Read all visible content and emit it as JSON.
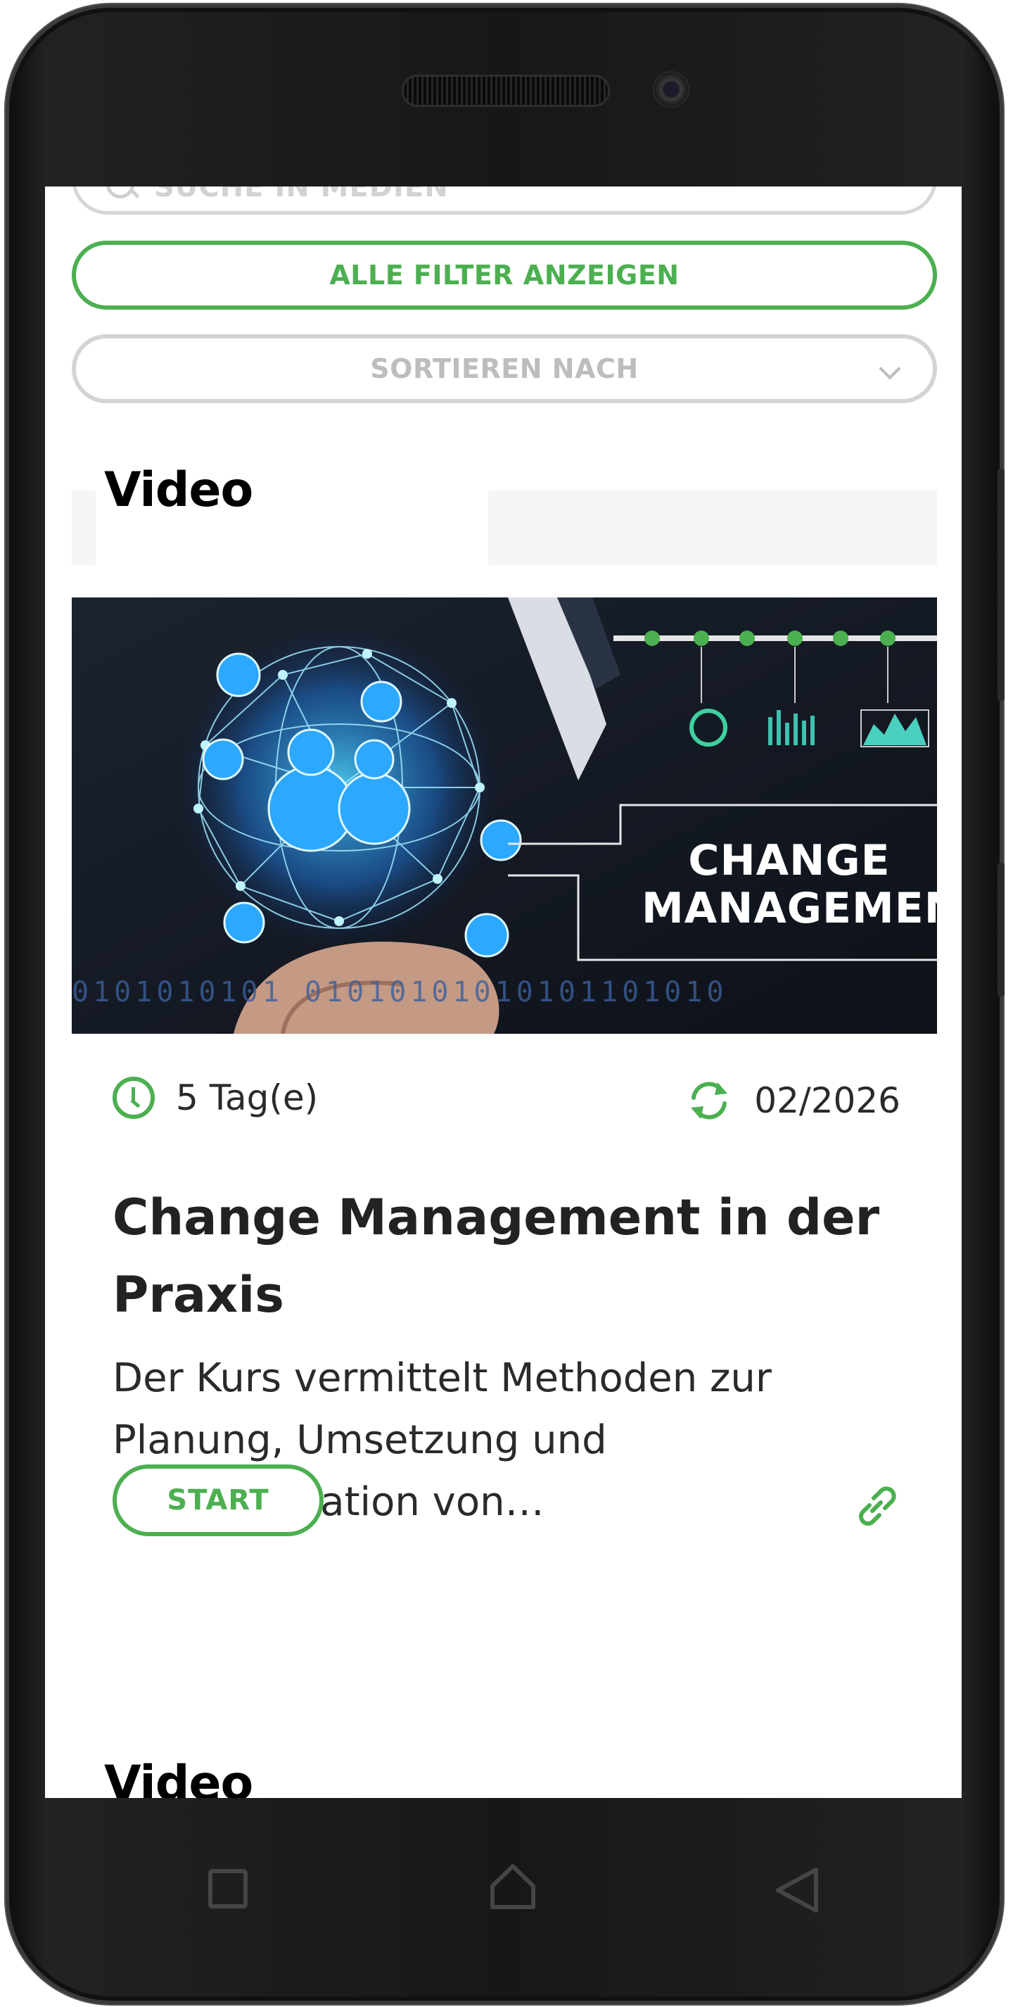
{
  "search": {
    "placeholder": "SUCHE IN MEDIEN"
  },
  "filters": {
    "show_all_label": "ALLE FILTER ANZEIGEN"
  },
  "sort": {
    "label": "SORTIEREN NACH"
  },
  "section": {
    "title": "Video"
  },
  "card": {
    "image_text_line1": "CHANGE",
    "image_text_line2": "MANAGEMENT",
    "image_binary": "0101010101 01010101010101101010",
    "duration": "5 Tag(e)",
    "update_date": "02/2026",
    "title": "Change Management in der Praxis",
    "description": "Der Kurs vermittelt Methoden zur Planung, Umsetzung und Kommunikation von…",
    "start_label": "START"
  },
  "next_section": {
    "title": "Video"
  },
  "colors": {
    "accent": "#4caf50",
    "border_gray": "#d4d4d4",
    "text_dark": "#222222"
  },
  "icons": [
    "search-icon",
    "chevron-down-icon",
    "clock-icon",
    "refresh-icon",
    "link-icon",
    "nav-recent-icon",
    "nav-home-icon",
    "nav-back-icon"
  ]
}
